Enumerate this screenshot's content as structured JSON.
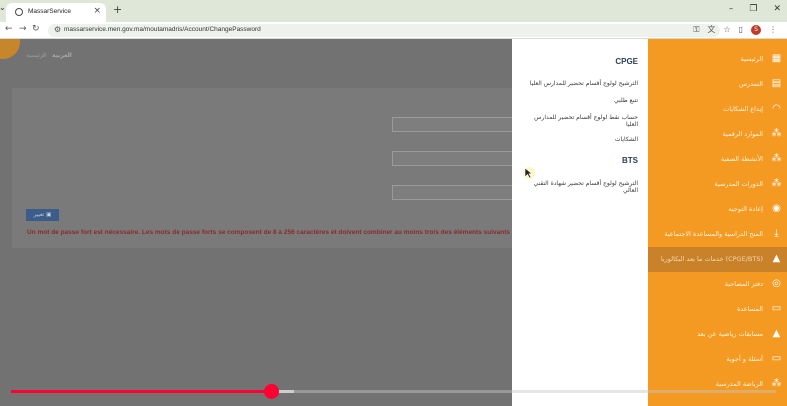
{
  "browser": {
    "tab_title": "MassarService",
    "url": "massarservice.men.gov.ma/moutamadris/Account/ChangePassword",
    "tabs_icon": "tab-search-icon",
    "new_tab_label": "+",
    "win_min": "–",
    "win_max": "❐",
    "win_close": "✕",
    "profile_initial": "S"
  },
  "page": {
    "breadcrumb_home": "الرئيسية",
    "breadcrumb_sep": "‹",
    "breadcrumb_current": "العربية",
    "save_label": "تغيير",
    "error_message": "Un mot de passe fort est nécessaire. Les mots de passe forts se composent de 8 à 256 caractères et doivent combiner au moins trois des éléments suivants : lettres majuscules"
  },
  "flyout": {
    "cpge_heading": "CPGE",
    "cpge_items": [
      "الترشيح لولوج أقسام تحضير للمدارس العليا",
      "تتبع طلبي",
      "حساب نقط لولوج أقسام تحضير للمدارس العليا",
      "الشكايات"
    ],
    "bts_heading": "BTS",
    "bts_items": [
      "الترشيح لولوج أقسام تحضير شهادة التقني العالي"
    ]
  },
  "sidebar": {
    "items": [
      {
        "label": "الرئيسية",
        "icon": "dashboard-icon"
      },
      {
        "label": "التمدرس",
        "icon": "book-icon"
      },
      {
        "label": "إيداع الشكايات",
        "icon": "headset-icon"
      },
      {
        "label": "الموارد الرقمية",
        "icon": "network-icon"
      },
      {
        "label": "الأنشطة الصفية",
        "icon": "network-icon"
      },
      {
        "label": "الدورات المدرسية",
        "icon": "network-icon"
      },
      {
        "label": "إعادة التوجيه",
        "icon": "compass-icon"
      },
      {
        "label": "المنح الدراسية والمساعدة الاجتماعية",
        "icon": "download-icon"
      },
      {
        "label": "خدمات ما بعد البكالوريا (CPGE/BTS)",
        "icon": "graduation-cap-icon"
      },
      {
        "label": "دفتر المصاحبة",
        "icon": "globe-icon"
      },
      {
        "label": "المساعدة",
        "icon": "image-icon"
      },
      {
        "label": "مسابقات رياضية عن بعد",
        "icon": "graduation-cap-icon"
      },
      {
        "label": "أسئلة و أجوبة",
        "icon": "image-icon"
      },
      {
        "label": "الرياضة المدرسية",
        "icon": "network-icon"
      }
    ],
    "active_index": 8
  },
  "video": {
    "played_fraction": 0.34,
    "buffered_fraction": 0.37
  },
  "colors": {
    "sidebar_orange": "#f49a22",
    "active_item": "#c9812a",
    "progress_red": "#ff0033",
    "heading_navy": "#2d3e58"
  }
}
